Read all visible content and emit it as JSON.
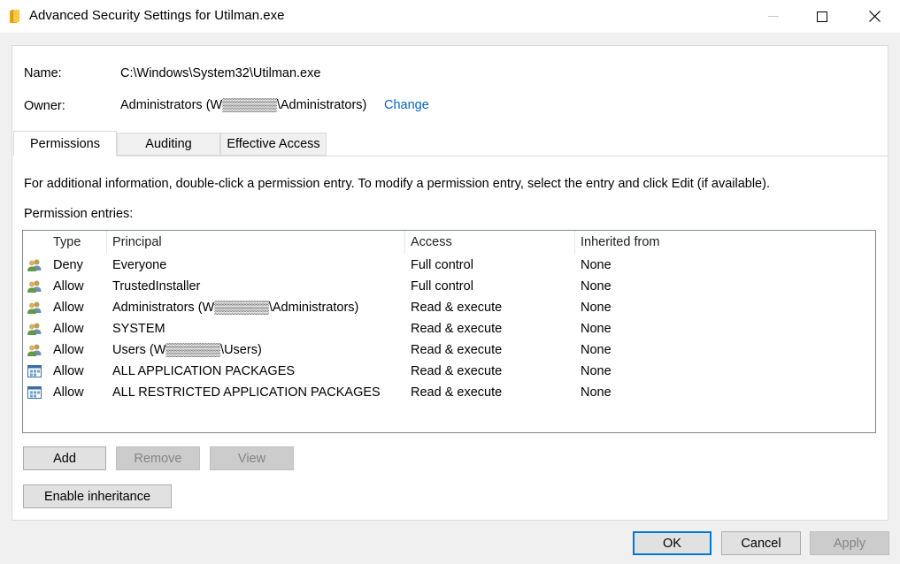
{
  "window": {
    "title": "Advanced Security Settings for Utilman.exe",
    "icon": "folder-icon",
    "controls": [
      "minimize-icon",
      "maximize-icon",
      "close-icon"
    ]
  },
  "object": {
    "name_label": "Name:",
    "name_value": "C:\\Windows\\System32\\Utilman.exe",
    "owner_label": "Owner:",
    "owner_value": "Administrators (W▒▒▒▒▒▒\\Administrators)",
    "change_link": "Change"
  },
  "tabs": [
    {
      "label": "Permissions",
      "active": true
    },
    {
      "label": "Auditing",
      "active": false
    },
    {
      "label": "Effective Access",
      "active": false
    }
  ],
  "info_text": "For additional information, double-click a permission entry. To modify a permission entry, select the entry and click Edit (if available).",
  "entries_label": "Permission entries:",
  "table": {
    "columns": [
      "Type",
      "Principal",
      "Access",
      "Inherited from"
    ],
    "rows": [
      {
        "icon": "user-group-icon",
        "type": "Deny",
        "principal": "Everyone",
        "access": "Full control",
        "inherited": "None"
      },
      {
        "icon": "user-group-icon",
        "type": "Allow",
        "principal": "TrustedInstaller",
        "access": "Full control",
        "inherited": "None"
      },
      {
        "icon": "user-group-icon",
        "type": "Allow",
        "principal": "Administrators (W▒▒▒▒▒▒\\Administrators)",
        "access": "Read & execute",
        "inherited": "None"
      },
      {
        "icon": "user-group-icon",
        "type": "Allow",
        "principal": "SYSTEM",
        "access": "Read & execute",
        "inherited": "None"
      },
      {
        "icon": "user-group-icon",
        "type": "Allow",
        "principal": "Users (W▒▒▒▒▒▒\\Users)",
        "access": "Read & execute",
        "inherited": "None"
      },
      {
        "icon": "app-package-icon",
        "type": "Allow",
        "principal": "ALL APPLICATION PACKAGES",
        "access": "Read & execute",
        "inherited": "None"
      },
      {
        "icon": "app-package-icon",
        "type": "Allow",
        "principal": "ALL RESTRICTED APPLICATION PACKAGES",
        "access": "Read & execute",
        "inherited": "None"
      }
    ]
  },
  "buttons": {
    "add": "Add",
    "remove": "Remove",
    "view": "View",
    "enable_inheritance": "Enable inheritance",
    "ok": "OK",
    "cancel": "Cancel",
    "apply": "Apply"
  },
  "colors": {
    "link": "#0066cc",
    "focus_border": "#0078d7",
    "disabled_text": "#838383"
  }
}
